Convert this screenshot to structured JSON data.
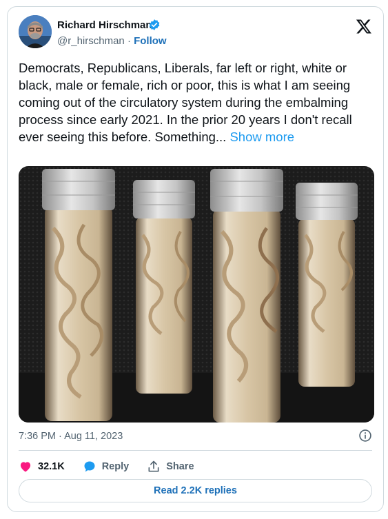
{
  "author": {
    "name": "Richard Hirschman",
    "handle": "@r_hirschman",
    "separator": "·",
    "follow_label": "Follow"
  },
  "tweet": {
    "text": "Democrats, Republicans, Liberals, far left or right, white or black, male or female, rich or poor, this is what I am seeing coming out of the circulatory system during the embalming process since early 2021. In the prior 20 years I don't recall ever seeing this before. Something...",
    "show_more_label": "Show more"
  },
  "meta": {
    "timestamp": "7:36 PM · Aug 11, 2023"
  },
  "actions": {
    "likes": "32.1K",
    "reply_label": "Reply",
    "share_label": "Share"
  },
  "read_replies_label": "Read 2.2K replies",
  "icons": {
    "verified": "verified-badge-icon",
    "platform": "x-logo-icon",
    "info": "info-icon",
    "like": "heart-icon",
    "reply": "reply-bubble-icon",
    "share": "share-upload-icon"
  },
  "colors": {
    "link": "#1d70b8",
    "show_more": "#1d9bf0",
    "like": "#f91880",
    "verified": "#1d9bf0",
    "muted": "#536471",
    "border": "#cfd9de"
  }
}
